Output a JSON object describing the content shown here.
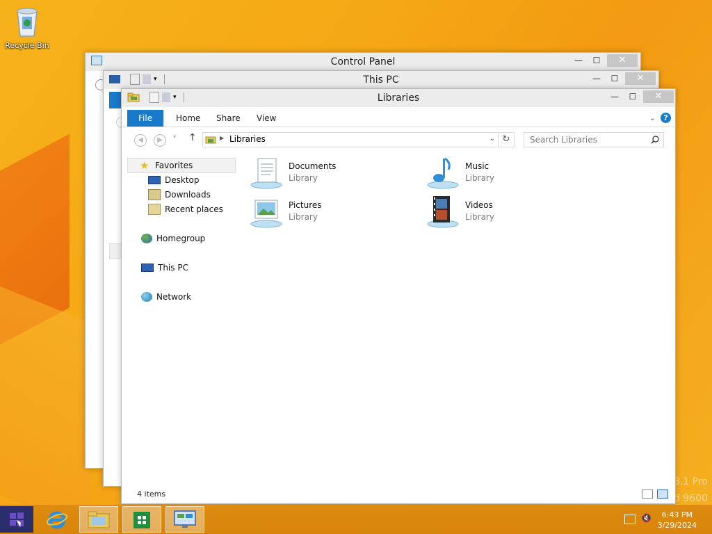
{
  "desktop": {
    "recycle_bin_label": "Recycle Bin",
    "watermark_line1": "8.1 Pro",
    "watermark_line2": "d 9600"
  },
  "windows": {
    "control_panel": {
      "title": "Control Panel"
    },
    "this_pc": {
      "title": "This PC"
    },
    "libraries": {
      "title": "Libraries",
      "ribbon_tabs": [
        "File",
        "Home",
        "Share",
        "View"
      ],
      "address": {
        "crumb": "Libraries"
      },
      "search": {
        "placeholder": "Search Libraries"
      },
      "nav": {
        "favorites": "Favorites",
        "desktop": "Desktop",
        "downloads": "Downloads",
        "recent": "Recent places",
        "homegroup": "Homegroup",
        "this_pc": "This PC",
        "network": "Network"
      },
      "items": [
        {
          "name": "Documents",
          "type": "Library",
          "icon": "documents-library-icon"
        },
        {
          "name": "Music",
          "type": "Library",
          "icon": "music-library-icon"
        },
        {
          "name": "Pictures",
          "type": "Library",
          "icon": "pictures-library-icon"
        },
        {
          "name": "Videos",
          "type": "Library",
          "icon": "videos-library-icon"
        }
      ],
      "status": "4 items"
    }
  },
  "taskbar": {
    "apps": [
      "start",
      "internet-explorer",
      "file-explorer",
      "store",
      "control-panel"
    ],
    "time": "6:43 PM",
    "date": "3/29/2024"
  },
  "colors": {
    "accent": "#1979ca",
    "wallpaper": "#f5a815",
    "taskbar": "#d8840c"
  }
}
